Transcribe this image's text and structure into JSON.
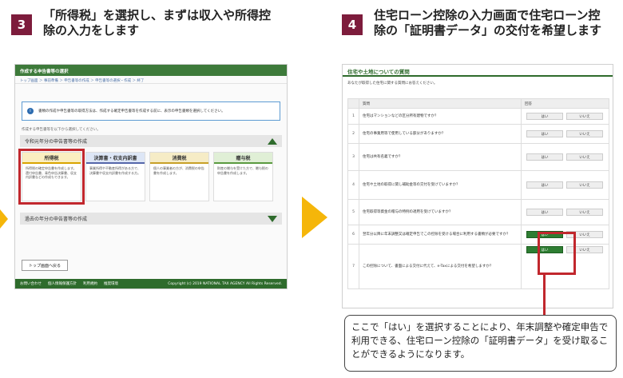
{
  "step3": {
    "number": "3",
    "title_line1": "「所得税」を選択し、まずは収入や所得控",
    "title_line2": "除の入力をします"
  },
  "step4": {
    "number": "4",
    "title_line1": "住宅ローン控除の入力画面で住宅ローン控",
    "title_line2": "除の「証明書データ」の交付を希望します"
  },
  "screen1": {
    "header": "作成する申告書等の選択",
    "breadcrumb": "トップ画面 ＞ 事前準備 ＞ 申告書等の作成 ＞ 申告書等の選択・作成 ＞ 終了",
    "info_text": "書類の作成や申告書等の取得方法は、作成する確定申告書等を作成する前に、表示の申告書類を選択してください。",
    "note": "作成する申告書等を以下から選択してください。",
    "section1": "令和元年分の申告書等の作成",
    "cards": [
      {
        "title": "所得税",
        "body": "所得税の確定申告書を作成します。還付申告書、青色申告決算書、収支内訳書などの作成もできます。"
      },
      {
        "title": "決算書・収支内訳書",
        "body": "事業所得や不動産所得がある方で、決算書や収支内訳書を作成する方。"
      },
      {
        "title": "消費税",
        "body": "個人の事業者の方が、消費税の申告書を作成します。"
      },
      {
        "title": "贈与税",
        "body": "財産の贈与を受けた方で、贈与税の申告書を作成します。"
      }
    ],
    "section2": "過去の年分の申告書等の作成",
    "back_button": "トップ画面へ戻る",
    "footer_links": [
      "お問い合わせ",
      "個人情報保護方針",
      "利用規約",
      "推奨環境"
    ],
    "copyright": "Copyright (c) 2019 NATIONAL TAX AGENCY All Rights Reserved."
  },
  "screen2": {
    "header": "住宅や土地についての質問",
    "subtitle": "あなたが取得した住宅に関する質問にお答えください。",
    "col_question": "質問",
    "col_answer": "回答",
    "rows": [
      {
        "num": "1",
        "text": "住宅はマンションなどの区分所有建物ですか？",
        "yes": "はい",
        "no": "いいえ",
        "yes_green": false
      },
      {
        "num": "2",
        "text": "住宅の事業用等で使用している部分がありますか？",
        "yes": "はい",
        "no": "いいえ",
        "yes_green": false
      },
      {
        "num": "3",
        "text": "住宅は共有名義ですか？",
        "yes": "はい",
        "no": "いいえ",
        "yes_green": false
      },
      {
        "num": "4",
        "text": "住宅や土地の取得に関し補助金等の交付を受けていますか？",
        "yes": "はい",
        "no": "いいえ",
        "yes_green": false
      },
      {
        "num": "5",
        "text": "住宅取得等資金の贈与の特例の適用を受けていますか？",
        "yes": "はい",
        "no": "いいえ",
        "yes_green": false
      },
      {
        "num": "6",
        "text": "翌年分以降に年末調整又は確定申告でこの控除を受ける場合に利用する書類が必要ですか？",
        "yes": "はい",
        "no": "いいえ",
        "yes_green": true
      },
      {
        "num": "7",
        "text": "この控除について、書面による交付に代えて、e-Taxによる交付を希望しますか？",
        "yes": "はい",
        "no": "いいえ",
        "yes_green": true
      }
    ]
  },
  "callout": "ここで「はい」を選択することにより、年末調整や確定申告で利用できる、住宅ローン控除の「証明書データ」を受け取ることができるようになります。"
}
